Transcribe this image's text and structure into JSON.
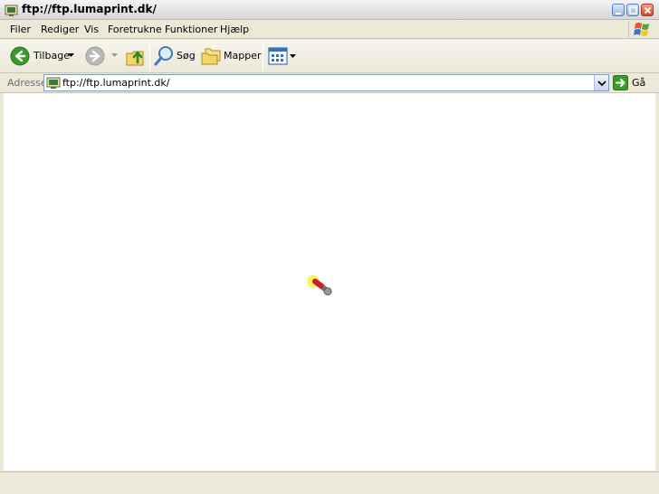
{
  "window": {
    "title": "ftp://ftp.lumaprint.dk/"
  },
  "menu": {
    "items": [
      "Filer",
      "Rediger",
      "Vis",
      "Foretrukne",
      "Funktioner",
      "Hjælp"
    ]
  },
  "toolbar": {
    "back_label": "Tilbage",
    "search_label": "Søg",
    "folders_label": "Mapper"
  },
  "address": {
    "label": "Adresse",
    "value": "ftp://ftp.lumaprint.dk/",
    "go_label": "Gå"
  },
  "status": {
    "text": ""
  },
  "colors": {
    "back_green": "#3a9a2c",
    "window_face": "#ece9d8",
    "close_red": "#d2462b"
  },
  "icons": {
    "title": "ftp-folder-icon",
    "back": "back-arrow-icon",
    "forward": "forward-arrow-icon",
    "up": "up-folder-icon",
    "search": "magnifier-icon",
    "folders": "folders-icon",
    "views": "views-icon",
    "go": "go-arrow-icon",
    "cursor": "busy-cursor-icon"
  }
}
